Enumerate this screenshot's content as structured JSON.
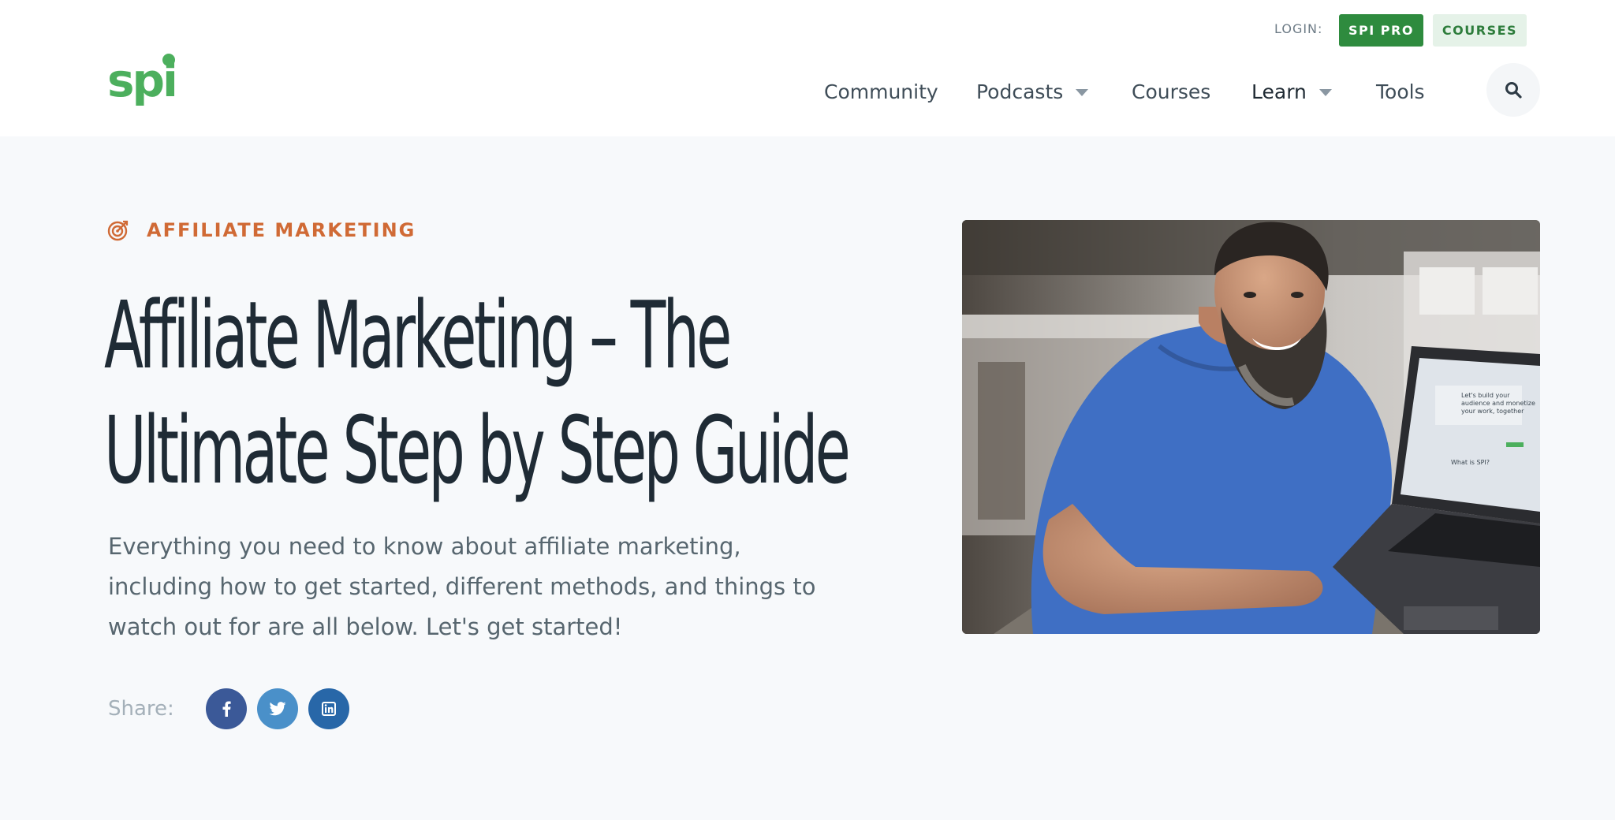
{
  "header": {
    "logo_text": "spi",
    "login_label": "LOGIN:",
    "pro_button": "SPI PRO",
    "courses_button": "COURSES",
    "nav": {
      "community": "Community",
      "podcasts": "Podcasts",
      "courses": "Courses",
      "learn": "Learn",
      "tools": "Tools"
    }
  },
  "hero": {
    "category": "AFFILIATE MARKETING",
    "title_line1": "Affiliate Marketing – The",
    "title_line2": "Ultimate Step by Step Guide",
    "lede": "Everything you need to know about affiliate marketing, including how to get started, different methods, and things to watch out for are all below. Let's get started!",
    "share_label": "Share:",
    "laptop_text_1": "Let's build your",
    "laptop_text_2": "audience and monetize",
    "laptop_text_3": "your work, together",
    "laptop_text_4": "What is SPI?"
  },
  "colors": {
    "brand_green": "#2e8b3e",
    "accent_orange": "#d06a35",
    "facebook": "#3b5998",
    "twitter": "#4a90c9",
    "linkedin": "#2867a8"
  }
}
